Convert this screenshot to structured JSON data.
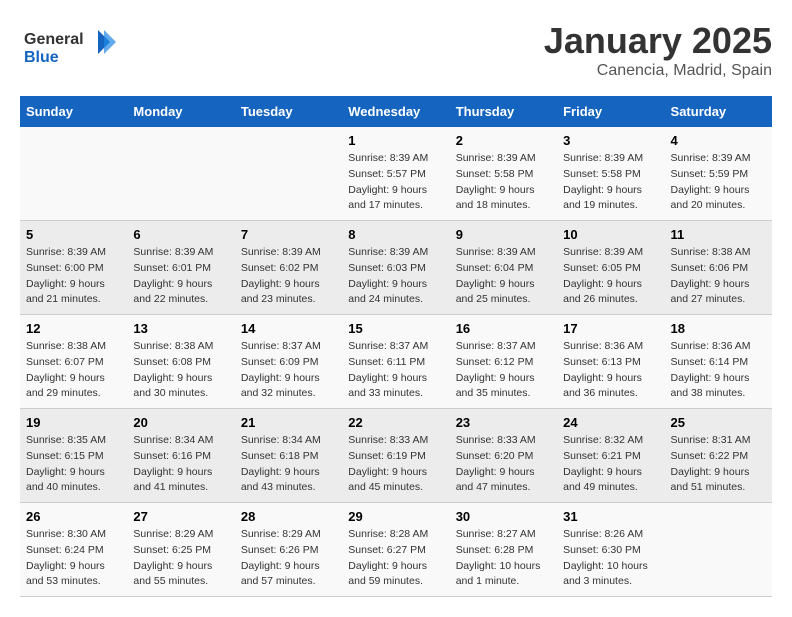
{
  "header": {
    "logo_general": "General",
    "logo_blue": "Blue",
    "month": "January 2025",
    "location": "Canencia, Madrid, Spain"
  },
  "weekdays": [
    "Sunday",
    "Monday",
    "Tuesday",
    "Wednesday",
    "Thursday",
    "Friday",
    "Saturday"
  ],
  "weeks": [
    [
      {
        "day": "",
        "detail": ""
      },
      {
        "day": "",
        "detail": ""
      },
      {
        "day": "",
        "detail": ""
      },
      {
        "day": "1",
        "detail": "Sunrise: 8:39 AM\nSunset: 5:57 PM\nDaylight: 9 hours\nand 17 minutes."
      },
      {
        "day": "2",
        "detail": "Sunrise: 8:39 AM\nSunset: 5:58 PM\nDaylight: 9 hours\nand 18 minutes."
      },
      {
        "day": "3",
        "detail": "Sunrise: 8:39 AM\nSunset: 5:58 PM\nDaylight: 9 hours\nand 19 minutes."
      },
      {
        "day": "4",
        "detail": "Sunrise: 8:39 AM\nSunset: 5:59 PM\nDaylight: 9 hours\nand 20 minutes."
      }
    ],
    [
      {
        "day": "5",
        "detail": "Sunrise: 8:39 AM\nSunset: 6:00 PM\nDaylight: 9 hours\nand 21 minutes."
      },
      {
        "day": "6",
        "detail": "Sunrise: 8:39 AM\nSunset: 6:01 PM\nDaylight: 9 hours\nand 22 minutes."
      },
      {
        "day": "7",
        "detail": "Sunrise: 8:39 AM\nSunset: 6:02 PM\nDaylight: 9 hours\nand 23 minutes."
      },
      {
        "day": "8",
        "detail": "Sunrise: 8:39 AM\nSunset: 6:03 PM\nDaylight: 9 hours\nand 24 minutes."
      },
      {
        "day": "9",
        "detail": "Sunrise: 8:39 AM\nSunset: 6:04 PM\nDaylight: 9 hours\nand 25 minutes."
      },
      {
        "day": "10",
        "detail": "Sunrise: 8:39 AM\nSunset: 6:05 PM\nDaylight: 9 hours\nand 26 minutes."
      },
      {
        "day": "11",
        "detail": "Sunrise: 8:38 AM\nSunset: 6:06 PM\nDaylight: 9 hours\nand 27 minutes."
      }
    ],
    [
      {
        "day": "12",
        "detail": "Sunrise: 8:38 AM\nSunset: 6:07 PM\nDaylight: 9 hours\nand 29 minutes."
      },
      {
        "day": "13",
        "detail": "Sunrise: 8:38 AM\nSunset: 6:08 PM\nDaylight: 9 hours\nand 30 minutes."
      },
      {
        "day": "14",
        "detail": "Sunrise: 8:37 AM\nSunset: 6:09 PM\nDaylight: 9 hours\nand 32 minutes."
      },
      {
        "day": "15",
        "detail": "Sunrise: 8:37 AM\nSunset: 6:11 PM\nDaylight: 9 hours\nand 33 minutes."
      },
      {
        "day": "16",
        "detail": "Sunrise: 8:37 AM\nSunset: 6:12 PM\nDaylight: 9 hours\nand 35 minutes."
      },
      {
        "day": "17",
        "detail": "Sunrise: 8:36 AM\nSunset: 6:13 PM\nDaylight: 9 hours\nand 36 minutes."
      },
      {
        "day": "18",
        "detail": "Sunrise: 8:36 AM\nSunset: 6:14 PM\nDaylight: 9 hours\nand 38 minutes."
      }
    ],
    [
      {
        "day": "19",
        "detail": "Sunrise: 8:35 AM\nSunset: 6:15 PM\nDaylight: 9 hours\nand 40 minutes."
      },
      {
        "day": "20",
        "detail": "Sunrise: 8:34 AM\nSunset: 6:16 PM\nDaylight: 9 hours\nand 41 minutes."
      },
      {
        "day": "21",
        "detail": "Sunrise: 8:34 AM\nSunset: 6:18 PM\nDaylight: 9 hours\nand 43 minutes."
      },
      {
        "day": "22",
        "detail": "Sunrise: 8:33 AM\nSunset: 6:19 PM\nDaylight: 9 hours\nand 45 minutes."
      },
      {
        "day": "23",
        "detail": "Sunrise: 8:33 AM\nSunset: 6:20 PM\nDaylight: 9 hours\nand 47 minutes."
      },
      {
        "day": "24",
        "detail": "Sunrise: 8:32 AM\nSunset: 6:21 PM\nDaylight: 9 hours\nand 49 minutes."
      },
      {
        "day": "25",
        "detail": "Sunrise: 8:31 AM\nSunset: 6:22 PM\nDaylight: 9 hours\nand 51 minutes."
      }
    ],
    [
      {
        "day": "26",
        "detail": "Sunrise: 8:30 AM\nSunset: 6:24 PM\nDaylight: 9 hours\nand 53 minutes."
      },
      {
        "day": "27",
        "detail": "Sunrise: 8:29 AM\nSunset: 6:25 PM\nDaylight: 9 hours\nand 55 minutes."
      },
      {
        "day": "28",
        "detail": "Sunrise: 8:29 AM\nSunset: 6:26 PM\nDaylight: 9 hours\nand 57 minutes."
      },
      {
        "day": "29",
        "detail": "Sunrise: 8:28 AM\nSunset: 6:27 PM\nDaylight: 9 hours\nand 59 minutes."
      },
      {
        "day": "30",
        "detail": "Sunrise: 8:27 AM\nSunset: 6:28 PM\nDaylight: 10 hours\nand 1 minute."
      },
      {
        "day": "31",
        "detail": "Sunrise: 8:26 AM\nSunset: 6:30 PM\nDaylight: 10 hours\nand 3 minutes."
      },
      {
        "day": "",
        "detail": ""
      }
    ]
  ]
}
